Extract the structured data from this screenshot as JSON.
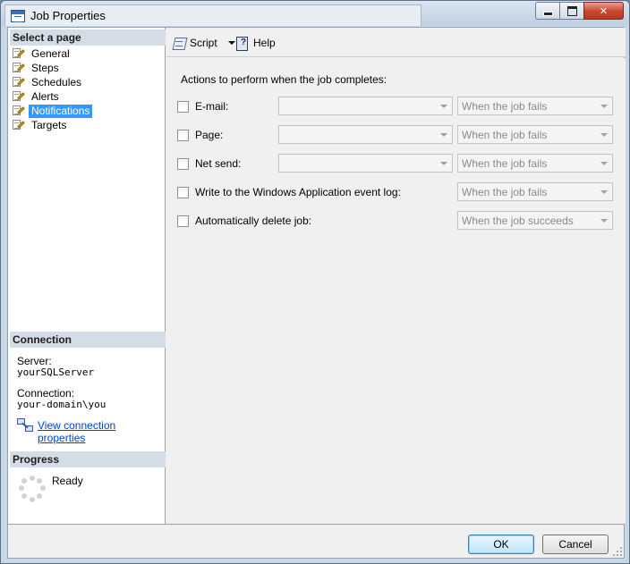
{
  "window": {
    "title": "Job Properties"
  },
  "left": {
    "select_page_header": "Select a page",
    "pages": [
      {
        "label": "General",
        "selected": false
      },
      {
        "label": "Steps",
        "selected": false
      },
      {
        "label": "Schedules",
        "selected": false
      },
      {
        "label": "Alerts",
        "selected": false
      },
      {
        "label": "Notifications",
        "selected": true
      },
      {
        "label": "Targets",
        "selected": false
      }
    ],
    "connection_header": "Connection",
    "server_label": "Server:",
    "server_value": "yourSQLServer",
    "connection_label": "Connection:",
    "connection_value": "your-domain\\you",
    "view_connection_link": "View connection properties",
    "progress_header": "Progress",
    "progress_status": "Ready"
  },
  "toolbar": {
    "script_label": "Script",
    "help_label": "Help"
  },
  "notifications": {
    "caption": "Actions to perform when the job completes:",
    "rows": [
      {
        "label": "E-mail:",
        "checked": false,
        "operator": "",
        "condition": "When the job fails",
        "has_operator": true
      },
      {
        "label": "Page:",
        "checked": false,
        "operator": "",
        "condition": "When the job fails",
        "has_operator": true
      },
      {
        "label": "Net send:",
        "checked": false,
        "operator": "",
        "condition": "When the job fails",
        "has_operator": true
      },
      {
        "label": "Write to the Windows Application event log:",
        "checked": false,
        "condition": "When the job fails",
        "has_operator": false
      },
      {
        "label": "Automatically delete job:",
        "checked": false,
        "condition": "When the job succeeds",
        "has_operator": false
      }
    ]
  },
  "buttons": {
    "ok": "OK",
    "cancel": "Cancel"
  },
  "colors": {
    "selection": "#3399ff",
    "section_header": "#d4dce8",
    "link": "#0044cc",
    "close_button": "#c7452d"
  }
}
